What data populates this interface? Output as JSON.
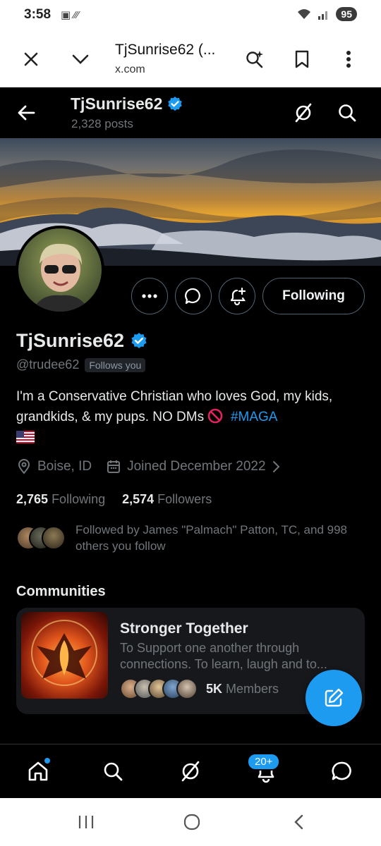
{
  "status_bar": {
    "time": "3:58",
    "battery": "95"
  },
  "browser": {
    "title": "TjSunrise62 (...",
    "url": "x.com"
  },
  "header": {
    "name": "TjSunrise62",
    "posts": "2,328 posts"
  },
  "profile": {
    "name": "TjSunrise62",
    "handle": "@trudee62",
    "follows_you": "Follows you",
    "following_button": "Following",
    "bio_text": "I'm a Conservative Christian who loves God, my kids, grandkids, & my pups.  NO DMs",
    "bio_hashtag": "#MAGA",
    "location": "Boise, ID",
    "joined": "Joined December 2022",
    "following_count": "2,765",
    "following_label": "Following",
    "followers_count": "2,574",
    "followers_label": "Followers",
    "followed_by": "Followed by James \"Palmach\" Patton, TC, and 998 others you follow"
  },
  "communities": {
    "title": "Communities",
    "card": {
      "name": "Stronger Together",
      "description": "To Support one another through connections. To learn, laugh and to...",
      "member_count": "5K",
      "member_label": "Members"
    }
  },
  "bottom_nav": {
    "notifications_badge": "20+"
  },
  "colors": {
    "accent": "#1d9bf0",
    "background": "#000000",
    "muted": "#71767b"
  }
}
